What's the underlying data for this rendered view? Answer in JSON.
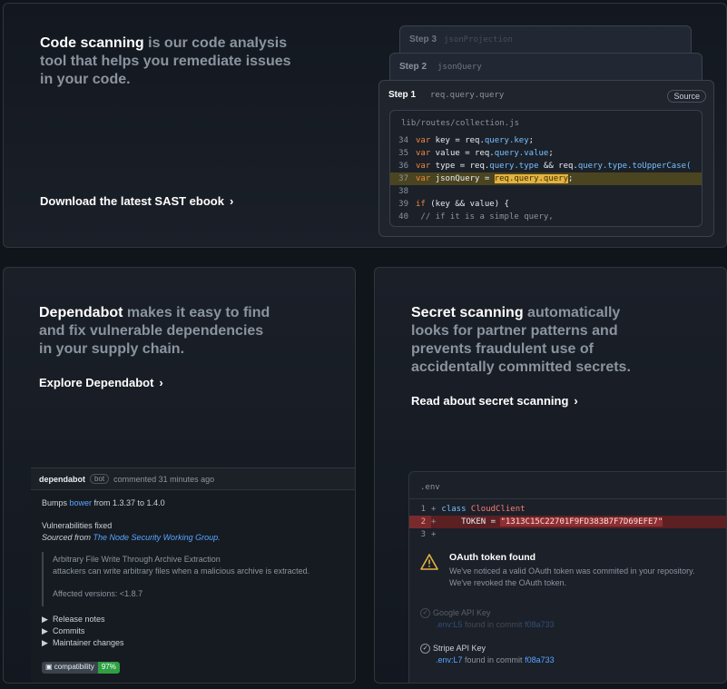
{
  "code_scanning": {
    "headline_strong": "Code scanning",
    "headline_rest": " is our code analysis tool that helps you remediate issues in your code.",
    "cta": "Download the latest SAST ebook",
    "steps": [
      {
        "label": "Step 3",
        "value": "jsonProjection"
      },
      {
        "label": "Step 2",
        "value": "jsonQuery"
      },
      {
        "label": "Step 1",
        "value": "req.query.query"
      }
    ],
    "source_badge": "Source",
    "file": "lib/routes/collection.js",
    "lines": {
      "n34": "34",
      "n35": "35",
      "n36": "36",
      "n37": "37",
      "n38": "38",
      "n39": "39",
      "n40": "40",
      "l34_kw": "var",
      "l34_a": " key = req.",
      "l34_p": "query.key",
      "l34_b": ";",
      "l35_kw": "var",
      "l35_a": " value = req.",
      "l35_p": "query.value",
      "l35_b": ";",
      "l36_kw": "var",
      "l36_a": " type = req.",
      "l36_p": "query.type",
      "l36_b": " && req.",
      "l36_p2": "query.type.toUpperCase(",
      "l37_kw": "var",
      "l37_a": " jsonQuery = ",
      "l37_mark": "req.query.query",
      "l37_b": ";",
      "l39_kw": "if",
      "l39_a": " (key && value) {",
      "l40": " // if it is a simple query,"
    }
  },
  "dependabot": {
    "headline_strong": "Dependabot",
    "headline_rest": " makes it easy to find and fix vulnerable dependencies in your supply chain.",
    "cta": "Explore Dependabot",
    "pr": {
      "author": "dependabot",
      "badge": "bot",
      "meta": "commented 31 minutes ago",
      "bumps_pre": "Bumps ",
      "bumps_link": "bower",
      "bumps_post": " from 1.3.37 to 1.4.0",
      "vuln": "Vulnerabilities fixed",
      "sourced_pre": "Sourced from ",
      "sourced_link": "The Node Security Working Group.",
      "quote_title": "Arbitrary File Write Through Archive Extraction",
      "quote_body": "attackers can write arbitrary files when a malicious archive is extracted.",
      "quote_affected": "Affected versions: <1.8.7",
      "details": [
        "Release notes",
        "Commits",
        "Maintainer changes"
      ],
      "compat_label": "compatibility",
      "compat_value": "97%"
    }
  },
  "secret_scanning": {
    "headline_strong": "Secret scanning",
    "headline_rest": " automatically looks for partner patterns and prevents fraudulent use of accidentally committed secrets.",
    "cta": "Read about secret scanning",
    "file": ".env",
    "lines": {
      "n1": "1",
      "n2": "2",
      "n3": "3",
      "l1_kw": "class",
      "l1_cls": " CloudClient",
      "l2_a": "    TOKEN = ",
      "l2_tok": "\"1313C15C22701F9FD383B7F7D69EFE7\""
    },
    "alert_title": "OAuth token found",
    "alert_line1": "We've noticed a valid OAuth token was commited in your repository.",
    "alert_line2": "We've revoked the OAuth token.",
    "hits": [
      {
        "name": "Google API Key",
        "file": ".env:L5",
        "found": " found in commit ",
        "sha": "f08a733"
      },
      {
        "name": "Stripe API Key",
        "file": ".env:L7",
        "found": " found in commit ",
        "sha": "f08a733"
      }
    ]
  },
  "colors": {
    "accent_link": "#58a6ff",
    "highlight": "#e3b341",
    "danger": "#f85149",
    "success": "#2ea043"
  }
}
